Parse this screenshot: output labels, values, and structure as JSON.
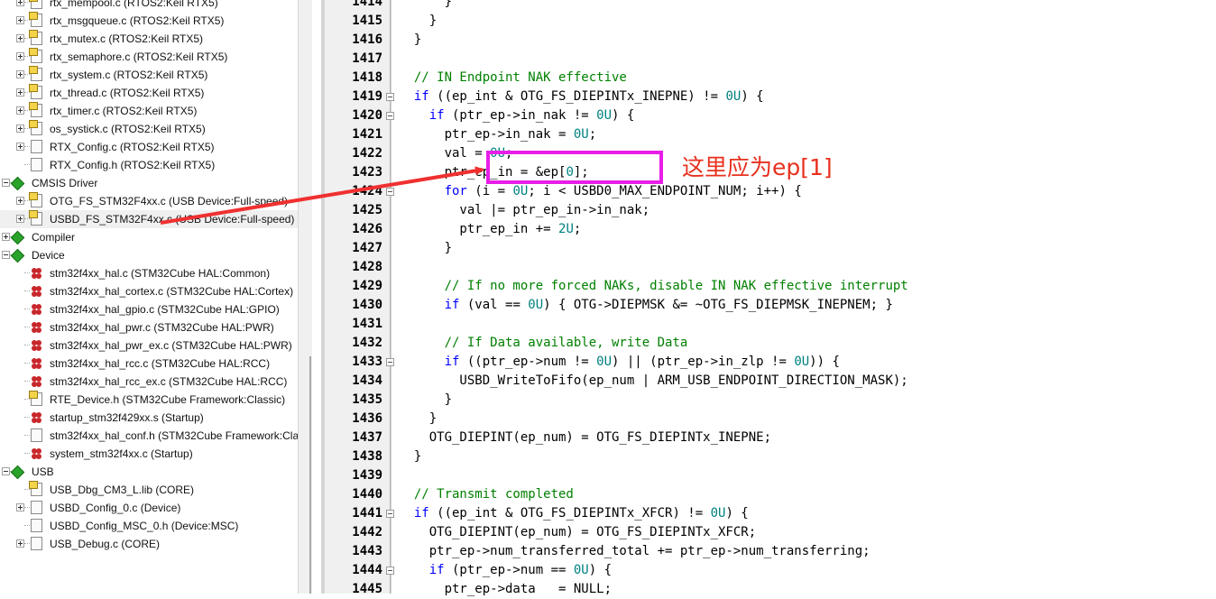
{
  "tree": {
    "items": [
      {
        "label": "rtx_mempool.c (RTOS2:Keil RTX5)",
        "expand": "plus",
        "icon": "locked"
      },
      {
        "label": "rtx_msgqueue.c (RTOS2:Keil RTX5)",
        "expand": "plus",
        "icon": "locked"
      },
      {
        "label": "rtx_mutex.c (RTOS2:Keil RTX5)",
        "expand": "plus",
        "icon": "locked"
      },
      {
        "label": "rtx_semaphore.c (RTOS2:Keil RTX5)",
        "expand": "plus",
        "icon": "locked"
      },
      {
        "label": "rtx_system.c (RTOS2:Keil RTX5)",
        "expand": "plus",
        "icon": "locked"
      },
      {
        "label": "rtx_thread.c (RTOS2:Keil RTX5)",
        "expand": "plus",
        "icon": "locked"
      },
      {
        "label": "rtx_timer.c (RTOS2:Keil RTX5)",
        "expand": "plus",
        "icon": "locked"
      },
      {
        "label": "os_systick.c (RTOS2:Keil RTX5)",
        "expand": "plus",
        "icon": "locked"
      },
      {
        "label": "RTX_Config.c (RTOS2:Keil RTX5)",
        "expand": "plus",
        "icon": "file"
      },
      {
        "label": "RTX_Config.h (RTOS2:Keil RTX5)",
        "expand": "none",
        "icon": "file"
      },
      {
        "label": "CMSIS Driver",
        "expand": "minus",
        "icon": "group",
        "level": 0
      },
      {
        "label": "OTG_FS_STM32F4xx.c (USB Device:Full-speed)",
        "expand": "plus",
        "icon": "locked"
      },
      {
        "label": "USBD_FS_STM32F4xx.c (USB Device:Full-speed)",
        "expand": "plus",
        "icon": "locked",
        "selected": true
      },
      {
        "label": "Compiler",
        "expand": "plus",
        "icon": "group",
        "level": 0
      },
      {
        "label": "Device",
        "expand": "minus",
        "icon": "group",
        "level": 0
      },
      {
        "label": "stm32f4xx_hal.c (STM32Cube HAL:Common)",
        "expand": "none",
        "icon": "hal"
      },
      {
        "label": "stm32f4xx_hal_cortex.c (STM32Cube HAL:Cortex)",
        "expand": "none",
        "icon": "hal"
      },
      {
        "label": "stm32f4xx_hal_gpio.c (STM32Cube HAL:GPIO)",
        "expand": "none",
        "icon": "hal"
      },
      {
        "label": "stm32f4xx_hal_pwr.c (STM32Cube HAL:PWR)",
        "expand": "none",
        "icon": "hal"
      },
      {
        "label": "stm32f4xx_hal_pwr_ex.c (STM32Cube HAL:PWR)",
        "expand": "none",
        "icon": "hal"
      },
      {
        "label": "stm32f4xx_hal_rcc.c (STM32Cube HAL:RCC)",
        "expand": "none",
        "icon": "hal"
      },
      {
        "label": "stm32f4xx_hal_rcc_ex.c (STM32Cube HAL:RCC)",
        "expand": "none",
        "icon": "hal"
      },
      {
        "label": "RTE_Device.h (STM32Cube Framework:Classic)",
        "expand": "none",
        "icon": "locked"
      },
      {
        "label": "startup_stm32f429xx.s (Startup)",
        "expand": "none",
        "icon": "hal"
      },
      {
        "label": "stm32f4xx_hal_conf.h (STM32Cube Framework:Class",
        "expand": "none",
        "icon": "file"
      },
      {
        "label": "system_stm32f4xx.c (Startup)",
        "expand": "none",
        "icon": "hal"
      },
      {
        "label": "USB",
        "expand": "minus",
        "icon": "group",
        "level": 0
      },
      {
        "label": "USB_Dbg_CM3_L.lib (CORE)",
        "expand": "none",
        "icon": "locked"
      },
      {
        "label": "USBD_Config_0.c (Device)",
        "expand": "plus",
        "icon": "file"
      },
      {
        "label": "USBD_Config_MSC_0.h (Device:MSC)",
        "expand": "none",
        "icon": "file"
      },
      {
        "label": "USB_Debug.c (CORE)",
        "expand": "plus",
        "icon": "file"
      }
    ]
  },
  "editor": {
    "lines": [
      {
        "n": "1414",
        "code": [
          {
            "t": "      }"
          }
        ]
      },
      {
        "n": "1415",
        "code": [
          {
            "t": "    }"
          }
        ]
      },
      {
        "n": "1416",
        "code": [
          {
            "t": "  }"
          }
        ]
      },
      {
        "n": "1417",
        "code": [
          {
            "t": ""
          }
        ]
      },
      {
        "n": "1418",
        "code": [
          {
            "t": "  // IN Endpoint NAK effective",
            "c": "cm"
          }
        ]
      },
      {
        "n": "1419",
        "fold": true,
        "code": [
          {
            "t": "  "
          },
          {
            "t": "if",
            "c": "kw"
          },
          {
            "t": " ((ep_int & OTG_FS_DIEPINTx_INEPNE) != "
          },
          {
            "t": "0U",
            "c": "nm"
          },
          {
            "t": ") {"
          }
        ]
      },
      {
        "n": "1420",
        "fold": true,
        "code": [
          {
            "t": "    "
          },
          {
            "t": "if",
            "c": "kw"
          },
          {
            "t": " (ptr_ep->in_nak != "
          },
          {
            "t": "0U",
            "c": "nm"
          },
          {
            "t": ") {"
          }
        ]
      },
      {
        "n": "1421",
        "code": [
          {
            "t": "      ptr_ep->in_nak = "
          },
          {
            "t": "0U",
            "c": "nm"
          },
          {
            "t": ";"
          }
        ]
      },
      {
        "n": "1422",
        "code": [
          {
            "t": "      val = "
          },
          {
            "t": "0U",
            "c": "nm"
          },
          {
            "t": ";"
          }
        ]
      },
      {
        "n": "1423",
        "code": [
          {
            "t": "      ptr_ep_in = &ep["
          },
          {
            "t": "0",
            "c": "nm"
          },
          {
            "t": "];"
          }
        ]
      },
      {
        "n": "1424",
        "fold": true,
        "code": [
          {
            "t": "      "
          },
          {
            "t": "for",
            "c": "kw"
          },
          {
            "t": " (i = "
          },
          {
            "t": "0U",
            "c": "nm"
          },
          {
            "t": "; i < USBD0_MAX_ENDPOINT_NUM; i++) {"
          }
        ]
      },
      {
        "n": "1425",
        "code": [
          {
            "t": "        val |= ptr_ep_in->in_nak;"
          }
        ]
      },
      {
        "n": "1426",
        "code": [
          {
            "t": "        ptr_ep_in += "
          },
          {
            "t": "2U",
            "c": "nm"
          },
          {
            "t": ";"
          }
        ]
      },
      {
        "n": "1427",
        "code": [
          {
            "t": "      }"
          }
        ]
      },
      {
        "n": "1428",
        "code": [
          {
            "t": ""
          }
        ]
      },
      {
        "n": "1429",
        "code": [
          {
            "t": "      // If no more forced NAKs, disable IN NAK effective interrupt",
            "c": "cm"
          }
        ]
      },
      {
        "n": "1430",
        "code": [
          {
            "t": "      "
          },
          {
            "t": "if",
            "c": "kw"
          },
          {
            "t": " (val == "
          },
          {
            "t": "0U",
            "c": "nm"
          },
          {
            "t": ") { OTG->DIEPMSK &= ~OTG_FS_DIEPMSK_INEPNEM; }"
          }
        ]
      },
      {
        "n": "1431",
        "code": [
          {
            "t": ""
          }
        ]
      },
      {
        "n": "1432",
        "code": [
          {
            "t": "      // If Data available, write Data",
            "c": "cm"
          }
        ]
      },
      {
        "n": "1433",
        "fold": true,
        "code": [
          {
            "t": "      "
          },
          {
            "t": "if",
            "c": "kw"
          },
          {
            "t": " ((ptr_ep->num != "
          },
          {
            "t": "0U",
            "c": "nm"
          },
          {
            "t": ") || (ptr_ep->in_zlp != "
          },
          {
            "t": "0U",
            "c": "nm"
          },
          {
            "t": ")) {"
          }
        ]
      },
      {
        "n": "1434",
        "code": [
          {
            "t": "        USBD_WriteToFifo(ep_num | ARM_USB_ENDPOINT_DIRECTION_MASK);"
          }
        ]
      },
      {
        "n": "1435",
        "code": [
          {
            "t": "      }"
          }
        ]
      },
      {
        "n": "1436",
        "code": [
          {
            "t": "    }"
          }
        ]
      },
      {
        "n": "1437",
        "code": [
          {
            "t": "    OTG_DIEPINT(ep_num) = OTG_FS_DIEPINTx_INEPNE;"
          }
        ]
      },
      {
        "n": "1438",
        "code": [
          {
            "t": "  }"
          }
        ]
      },
      {
        "n": "1439",
        "code": [
          {
            "t": ""
          }
        ]
      },
      {
        "n": "1440",
        "code": [
          {
            "t": "  // Transmit completed",
            "c": "cm"
          }
        ]
      },
      {
        "n": "1441",
        "fold": true,
        "code": [
          {
            "t": "  "
          },
          {
            "t": "if",
            "c": "kw"
          },
          {
            "t": " ((ep_int & OTG_FS_DIEPINTx_XFCR) != "
          },
          {
            "t": "0U",
            "c": "nm"
          },
          {
            "t": ") {"
          }
        ]
      },
      {
        "n": "1442",
        "code": [
          {
            "t": "    OTG_DIEPINT(ep_num) = OTG_FS_DIEPINTx_XFCR;"
          }
        ]
      },
      {
        "n": "1443",
        "code": [
          {
            "t": "    ptr_ep->num_transferred_total += ptr_ep->num_transferring;"
          }
        ]
      },
      {
        "n": "1444",
        "fold": true,
        "code": [
          {
            "t": "    "
          },
          {
            "t": "if",
            "c": "kw"
          },
          {
            "t": " (ptr_ep->num == "
          },
          {
            "t": "0U",
            "c": "nm"
          },
          {
            "t": ") {"
          }
        ]
      },
      {
        "n": "1445",
        "code": [
          {
            "t": "      ptr_ep->data   = NULL;"
          }
        ]
      }
    ]
  },
  "annotation": {
    "text": "这里应为ep[1]",
    "box_color": "#e81ee8",
    "arrow_color": "#f03030"
  }
}
